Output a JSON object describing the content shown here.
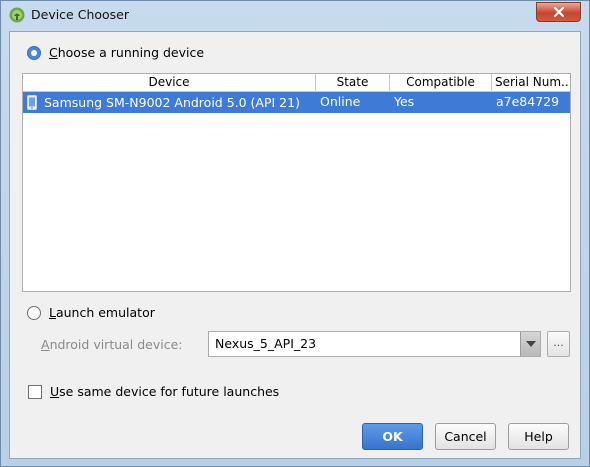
{
  "window": {
    "title": "Device Chooser"
  },
  "choose_running": {
    "label": "Choose a running device",
    "selected": true
  },
  "device_table": {
    "columns": [
      "Device",
      "State",
      "Compatible",
      "Serial Num..."
    ],
    "rows": [
      {
        "device": "Samsung SM-N9002 Android 5.0 (API 21)",
        "state": "Online",
        "compatible": "Yes",
        "serial": "a7e84729",
        "selected": true
      }
    ]
  },
  "launch_emulator": {
    "label": "Launch emulator",
    "selected": false,
    "avd_label": "Android virtual device:",
    "avd_value": "Nexus_5_API_23",
    "browse_label": "..."
  },
  "same_device": {
    "label": "Use same device for future launches",
    "checked": false
  },
  "buttons": {
    "ok": "OK",
    "cancel": "Cancel",
    "help": "Help"
  },
  "colors": {
    "selection": "#3d7bd6",
    "primary_button": "#3a73cb",
    "close_button": "#c7452f"
  }
}
